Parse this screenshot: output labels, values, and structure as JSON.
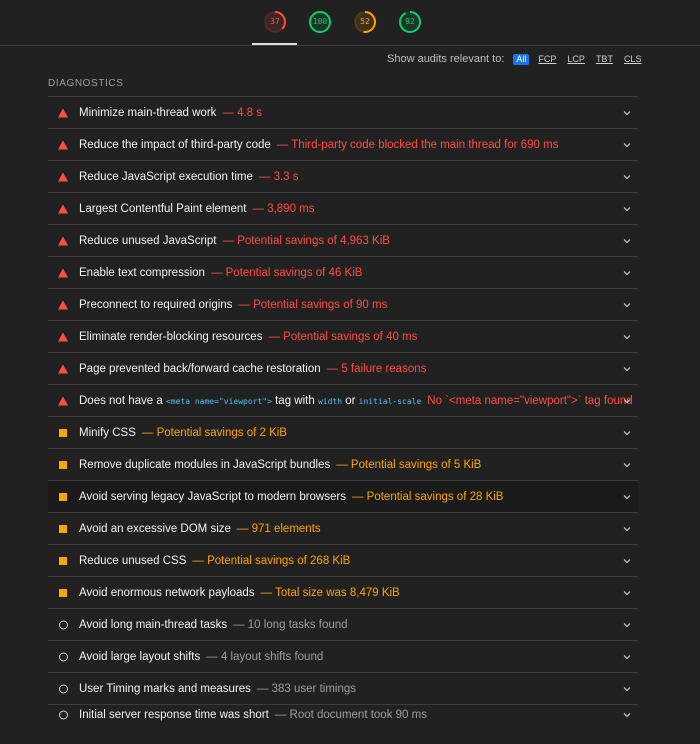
{
  "scores": [
    {
      "value": "37",
      "color": "#ff4e42",
      "fraction": 0.37
    },
    {
      "value": "100",
      "color": "#0cce6b",
      "fraction": 1.0
    },
    {
      "value": "52",
      "color": "#ffa400",
      "fraction": 0.52
    },
    {
      "value": "92",
      "color": "#0cce6b",
      "fraction": 0.92
    }
  ],
  "filter": {
    "label": "Show audits relevant to:",
    "chips": [
      "All",
      "FCP",
      "LCP",
      "TBT",
      "CLS"
    ],
    "active": "All"
  },
  "section_title": "DIAGNOSTICS",
  "audits": [
    {
      "status": "fail",
      "title": "Minimize main-thread work",
      "display": "— 4.8 s"
    },
    {
      "status": "fail",
      "title": "Reduce the impact of third-party code",
      "display": "— Third-party code blocked the main thread for 690 ms"
    },
    {
      "status": "fail",
      "title": "Reduce JavaScript execution time",
      "display": "— 3.3 s"
    },
    {
      "status": "fail",
      "title": "Largest Contentful Paint element",
      "display": "— 3,890 ms"
    },
    {
      "status": "fail",
      "title": "Reduce unused JavaScript",
      "display": "— Potential savings of 4,963 KiB"
    },
    {
      "status": "fail",
      "title": "Enable text compression",
      "display": "— Potential savings of 46 KiB"
    },
    {
      "status": "fail",
      "title": "Preconnect to required origins",
      "display": "— Potential savings of 90 ms"
    },
    {
      "status": "fail",
      "title": "Eliminate render-blocking resources",
      "display": "— Potential savings of 40 ms"
    },
    {
      "status": "fail",
      "title": "Page prevented back/forward cache restoration",
      "display": "— 5 failure reasons"
    },
    {
      "status": "fail",
      "title_parts": [
        "Does not have a ",
        "<meta name=\"viewport\">",
        " tag with ",
        "width",
        " or ",
        "initial-scale"
      ],
      "display": "No `<meta name=\"viewport\">` tag found"
    },
    {
      "status": "average",
      "title": "Minify CSS",
      "display": "— Potential savings of 2 KiB"
    },
    {
      "status": "average",
      "title": "Remove duplicate modules in JavaScript bundles",
      "display": "— Potential savings of 5 KiB"
    },
    {
      "status": "average",
      "title": "Avoid serving legacy JavaScript to modern browsers",
      "display": "— Potential savings of 28 KiB"
    },
    {
      "status": "average",
      "title": "Avoid an excessive DOM size",
      "display": "— 971 elements"
    },
    {
      "status": "average",
      "title": "Reduce unused CSS",
      "display": "— Potential savings of 268 KiB"
    },
    {
      "status": "average",
      "title": "Avoid enormous network payloads",
      "display": "— Total size was 8,479 KiB"
    },
    {
      "status": "info",
      "title": "Avoid long main-thread tasks",
      "display": "— 10 long tasks found"
    },
    {
      "status": "info",
      "title": "Avoid large layout shifts",
      "display": "— 4 layout shifts found"
    },
    {
      "status": "info",
      "title": "User Timing marks and measures",
      "display": "— 383 user timings"
    },
    {
      "status": "info",
      "title": "Initial server response time was short",
      "display": "— Root document took 90 ms"
    }
  ],
  "icons": {
    "fail": "red-triangle-icon",
    "average": "orange-square-icon",
    "info": "grey-circle-icon",
    "expand": "chevron-down-icon"
  },
  "colors": {
    "fail": "#ff4e42",
    "average": "#ffa400",
    "pass": "#0cce6b",
    "info": "#9e9e9e",
    "accent": "#1a73e8"
  }
}
